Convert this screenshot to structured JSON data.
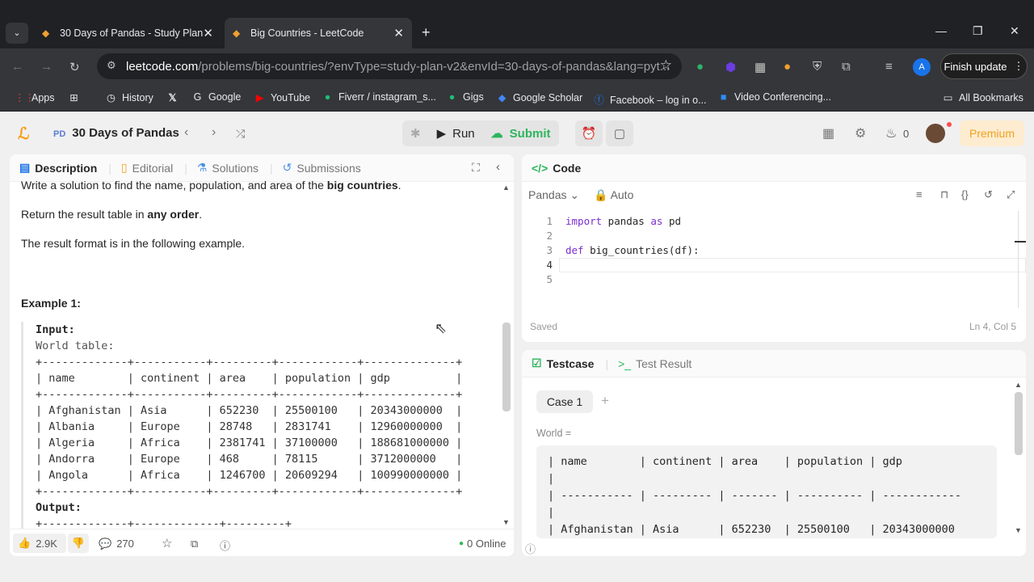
{
  "browser": {
    "tabs": [
      {
        "title": "30 Days of Pandas - Study Plan",
        "active": false
      },
      {
        "title": "Big Countries - LeetCode",
        "active": true
      }
    ],
    "url_host": "leetcode.com",
    "url_path": "/problems/big-countries/?envType=study-plan-v2&envId=30-days-of-pandas&lang=pyt...",
    "finish_update": "Finish update",
    "profile_letter": "A",
    "bookmarks": [
      "Apps",
      "History",
      "Google",
      "YouTube",
      "Fiverr / instagram_s...",
      "Gigs",
      "Google Scholar",
      "Facebook – log in o...",
      "Video Conferencing..."
    ],
    "all_bookmarks": "All Bookmarks"
  },
  "header": {
    "plan_badge": "PD",
    "plan_title": "30 Days of Pandas",
    "run": "Run",
    "submit": "Submit",
    "streak": "0",
    "premium": "Premium"
  },
  "description": {
    "tabs": [
      "Description",
      "Editorial",
      "Solutions",
      "Submissions"
    ],
    "line1_pre": "Write a solution to find the name, population, and area of the ",
    "line1_bold": "big countries",
    "line1_post": ".",
    "line2_pre": "Return the result table in ",
    "line2_bold": "any order",
    "line2_post": ".",
    "line3": "The result format is in the following example.",
    "example_title": "Example 1:",
    "input_label": "Input:",
    "table_label": "World table:",
    "table_border": "+-------------+-----------+---------+------------+--------------+",
    "table_header": "| name        | continent | area    | population | gdp          |",
    "table_rows": [
      "| Afghanistan | Asia      | 652230  | 25500100   | 20343000000  |",
      "| Albania     | Europe    | 28748   | 2831741    | 12960000000  |",
      "| Algeria     | Africa    | 2381741 | 37100000   | 188681000000 |",
      "| Andorra     | Europe    | 468     | 78115      | 3712000000   |",
      "| Angola      | Africa    | 1246700 | 20609294   | 100990000000 |"
    ],
    "output_label": "Output:",
    "output_border": "+-------------+-------------+---------+"
  },
  "footer": {
    "likes": "2.9K",
    "comments": "270",
    "online": "0 Online"
  },
  "code": {
    "title": "Code",
    "language": "Pandas",
    "mode": "Auto",
    "lines": [
      "import pandas as pd",
      "",
      "def big_countries(df):",
      "",
      ""
    ],
    "saved": "Saved",
    "position": "Ln 4, Col 5"
  },
  "testcase": {
    "tab_testcase": "Testcase",
    "tab_result": "Test Result",
    "case": "Case 1",
    "var_label": "World =",
    "content": "| name        | continent | area    | population | gdp\n|\n| ----------- | --------- | ------- | ---------- | ------------\n|\n| Afghanistan | Asia      | 652230  | 25500100   | 20343000000"
  }
}
